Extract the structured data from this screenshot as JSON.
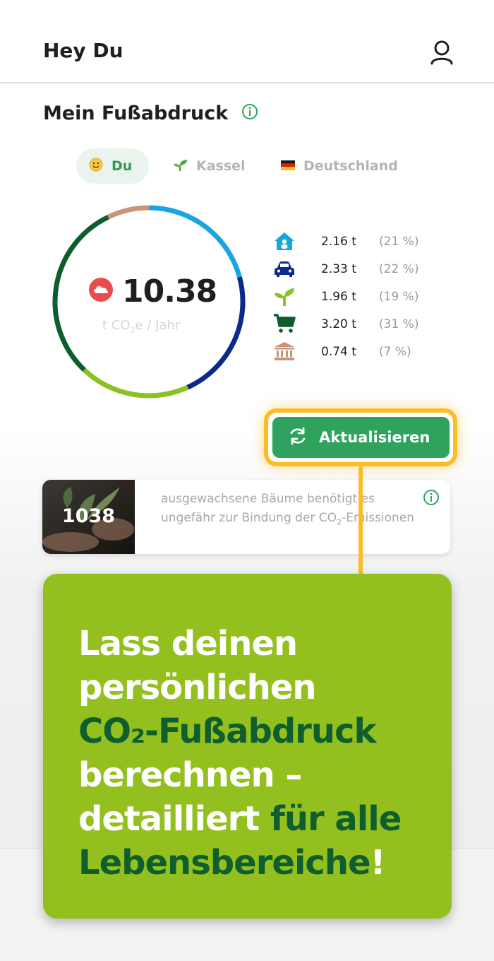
{
  "header": {
    "greeting": "Hey Du",
    "user_icon": "user-icon"
  },
  "footprint": {
    "title": "Mein Fußabdruck",
    "info_icon": "info-icon",
    "tabs": [
      {
        "label": "Du",
        "icon": "smiley-icon",
        "active": true
      },
      {
        "label": "Kassel",
        "icon": "sprout-icon",
        "active": false
      },
      {
        "label": "Deutschland",
        "icon": "german-flag-icon",
        "active": false
      }
    ],
    "total": {
      "value": "10.38",
      "unit": "t CO",
      "unit_sub": "2",
      "unit_rest": "e / Jahr",
      "icon": "cloud-icon"
    },
    "categories": [
      {
        "icon": "house-icon",
        "value": "2.16 t",
        "percent": "(21 %)",
        "color": "#19a6e0"
      },
      {
        "icon": "car-icon",
        "value": "2.33 t",
        "percent": "(22 %)",
        "color": "#0b2a8c"
      },
      {
        "icon": "sprout-icon",
        "value": "1.96 t",
        "percent": "(19 %)",
        "color": "#8cc024"
      },
      {
        "icon": "cart-icon",
        "value": "3.20 t",
        "percent": "(31 %)",
        "color": "#0f5c2c"
      },
      {
        "icon": "bank-icon",
        "value": "0.74 t",
        "percent": "(7 %)",
        "color": "#c8957a"
      }
    ]
  },
  "update_button": {
    "label": "Aktualisieren",
    "icon": "refresh-icon"
  },
  "trees": {
    "count": "1038",
    "text_1": "ausgewachsene Bäume benötigt es ungefähr zur Bindung der CO",
    "text_sub": "2",
    "text_2": "-Emissionen"
  },
  "promo": {
    "line_1": "Lass deinen",
    "line_2": "persönlichen",
    "line_3": "CO₂-Fußabdruck",
    "line_4": "berechnen –",
    "line_5a": "detailliert ",
    "line_5b": "für alle",
    "line_6": "Lebensbereiche",
    "line_6_end": "!"
  },
  "colors": {
    "accent": "#2fa35e",
    "highlight": "#fbbd24",
    "promo_bg": "#93c01f",
    "promo_dark": "#0e5e2e"
  }
}
